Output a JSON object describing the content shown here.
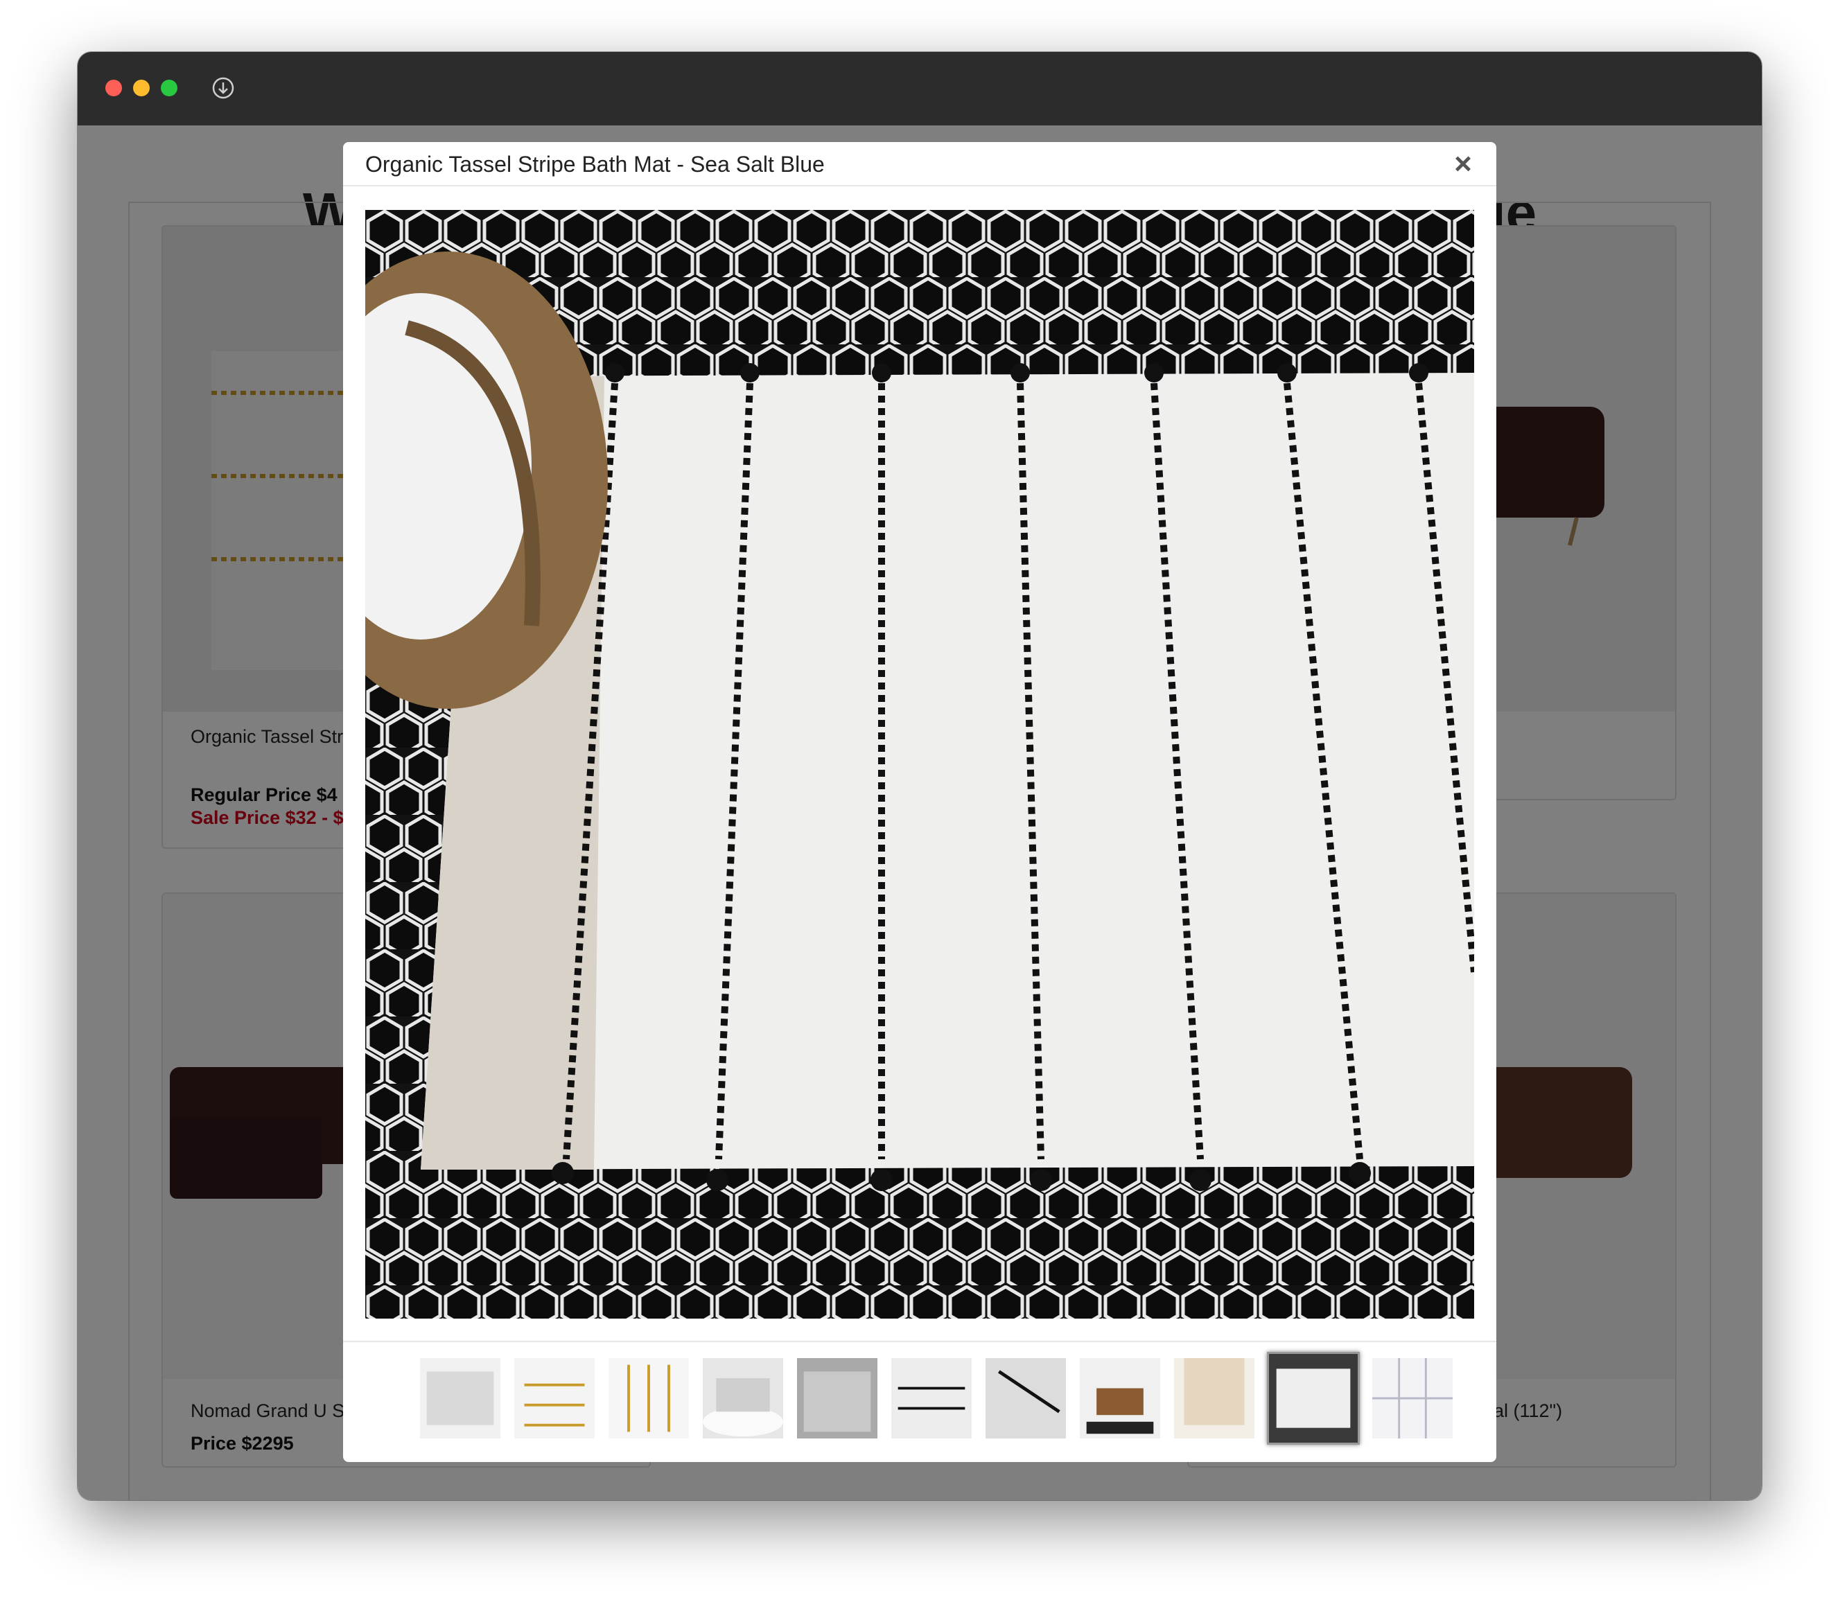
{
  "window": {
    "controls": [
      "close",
      "minimize",
      "zoom"
    ],
    "toolbar_icon": "download-icon"
  },
  "page": {
    "title": "Williams Sonoma Quality Challenge: Top Value"
  },
  "products": [
    {
      "name": "Organic Tassel Stripe Bath Mat - Horseradish",
      "regular_price": "Regular Price $4",
      "sale_price": "Sale Price $32 - $"
    },
    {
      "name": "Nomad Grand U S",
      "price": "Price $2295"
    },
    {
      "name": "al (112\")"
    }
  ],
  "modal": {
    "title": "Organic Tassel Stripe Bath Mat - Sea Salt Blue",
    "close_label": "×",
    "thumbnail_count": 11,
    "selected_thumbnail_index": 9,
    "thumbnails": [
      "mat-grey-thumb",
      "mat-tassel-thumb",
      "mat-tassel-gold-thumb",
      "bathtub-mat-thumb",
      "mat-texture-thumb",
      "mat-black-stripe-thumb",
      "mat-stripe-edge-thumb",
      "vanity-room-thumb",
      "shower-curtain-thumb",
      "mat-black-tile-thumb",
      "curtain-plaid-thumb"
    ]
  },
  "colors": {
    "titlebar": "#2c2c2c",
    "sale_red": "#d0021b",
    "overlay": "rgba(0,0,0,0.5)"
  }
}
